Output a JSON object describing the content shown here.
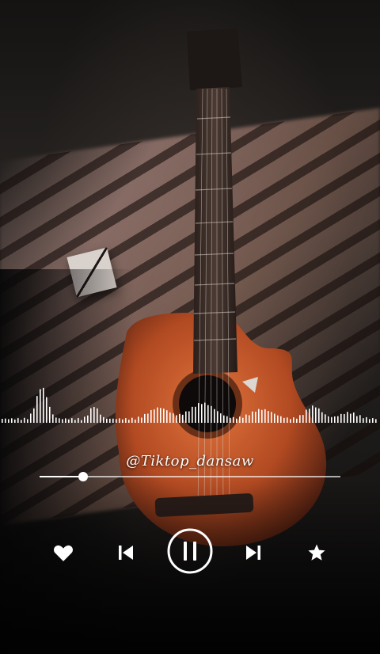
{
  "player": {
    "watermark": "@Tiktop_dansaw",
    "progress_fraction": 0.145,
    "state": "playing"
  },
  "controls": {
    "like_icon": "heart-icon",
    "previous_icon": "skip-previous-icon",
    "play_pause_icon": "pause-icon",
    "next_icon": "skip-next-icon",
    "favorite_icon": "star-icon"
  },
  "colors": {
    "accent": "#ffffff",
    "guitar_body": "#c4582c"
  }
}
